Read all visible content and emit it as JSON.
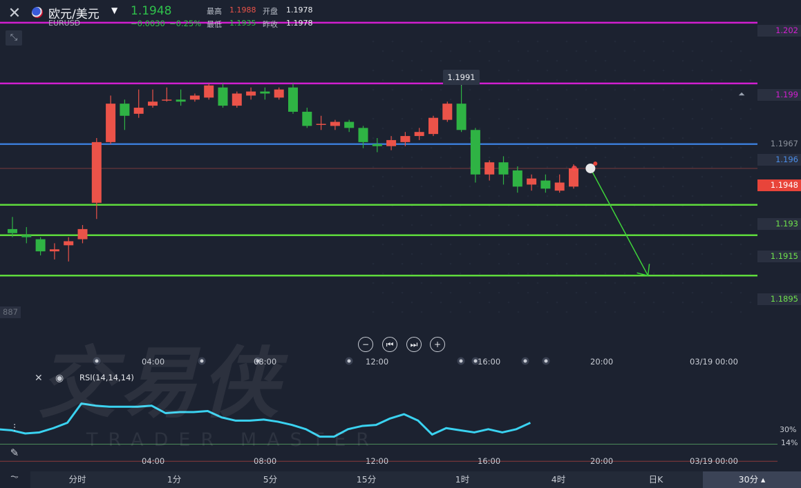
{
  "header": {
    "close_icon": "close-icon",
    "symbol_name": "欧元/美元",
    "symbol_code": "EURUSD",
    "price": "1.1948",
    "change": "−0.0030",
    "change_pct": "−0.25%",
    "high_label": "最高",
    "high_value": "1.1988",
    "open_label": "开盘",
    "open_value": "1.1978",
    "low_label": "最低",
    "low_value": "1.1935",
    "prev_label": "昨收",
    "prev_value": "1.1978"
  },
  "watermark": {
    "cn": "交易侠",
    "en": "TRADER MASTER"
  },
  "price_labels": {
    "l1": "1.202",
    "l2": "1.199",
    "l3": "1.1967",
    "l4": "1.196",
    "current": "1.1948",
    "l5": "1.193",
    "l6": "1.1915",
    "l7": "1.1895",
    "cut": "887"
  },
  "tooltip": "1.1991",
  "time_labels": [
    "04:00",
    "08:00",
    "12:00",
    "16:00",
    "20:00",
    "03/19 00:00"
  ],
  "rsi": {
    "label": "RSI(14,14,14)",
    "level30": "30%",
    "level14": "14%"
  },
  "timeframes": [
    "分时",
    "1分",
    "5分",
    "15分",
    "1时",
    "4时",
    "日K",
    "30分"
  ],
  "colors": {
    "up": "#eb5349",
    "down": "#2fb344",
    "blue_line": "#3a7bd5",
    "magenta_line": "#d21fd0",
    "green_line": "#5fdc3c",
    "rsi": "#3ad2f0"
  },
  "chart_data": {
    "type": "candlestick",
    "ylim": [
      1.1876,
      1.2021
    ],
    "levels": [
      {
        "value": 1.202,
        "color": "#d21fd0"
      },
      {
        "value": 1.199,
        "color": "#d21fd0"
      },
      {
        "value": 1.196,
        "color": "#3a7bd5"
      },
      {
        "value": 1.193,
        "color": "#5fdc3c"
      },
      {
        "value": 1.1915,
        "color": "#5fdc3c"
      },
      {
        "value": 1.1895,
        "color": "#5fdc3c"
      }
    ],
    "current_price": 1.1948,
    "candles": [
      {
        "o": 1.1918,
        "h": 1.1924,
        "l": 1.1914,
        "c": 1.1916
      },
      {
        "o": 1.1915,
        "h": 1.1919,
        "l": 1.1911,
        "c": 1.1914
      },
      {
        "o": 1.1913,
        "h": 1.1914,
        "l": 1.1905,
        "c": 1.1907
      },
      {
        "o": 1.1907,
        "h": 1.1911,
        "l": 1.1903,
        "c": 1.1908
      },
      {
        "o": 1.191,
        "h": 1.1914,
        "l": 1.1902,
        "c": 1.1912
      },
      {
        "o": 1.1913,
        "h": 1.192,
        "l": 1.1911,
        "c": 1.1918
      },
      {
        "o": 1.1931,
        "h": 1.1963,
        "l": 1.1923,
        "c": 1.1961
      },
      {
        "o": 1.1961,
        "h": 1.1984,
        "l": 1.196,
        "c": 1.198
      },
      {
        "o": 1.198,
        "h": 1.1982,
        "l": 1.1967,
        "c": 1.1974
      },
      {
        "o": 1.1975,
        "h": 1.1987,
        "l": 1.1973,
        "c": 1.1978
      },
      {
        "o": 1.1979,
        "h": 1.1987,
        "l": 1.1978,
        "c": 1.1981
      },
      {
        "o": 1.1982,
        "h": 1.1988,
        "l": 1.1981,
        "c": 1.1982
      },
      {
        "o": 1.1982,
        "h": 1.1987,
        "l": 1.1979,
        "c": 1.1981
      },
      {
        "o": 1.1982,
        "h": 1.1985,
        "l": 1.1981,
        "c": 1.1984
      },
      {
        "o": 1.1983,
        "h": 1.199,
        "l": 1.1982,
        "c": 1.1989
      },
      {
        "o": 1.1988,
        "h": 1.199,
        "l": 1.1978,
        "c": 1.1979
      },
      {
        "o": 1.1979,
        "h": 1.1986,
        "l": 1.1978,
        "c": 1.1985
      },
      {
        "o": 1.1984,
        "h": 1.1988,
        "l": 1.1982,
        "c": 1.1986
      },
      {
        "o": 1.1986,
        "h": 1.1988,
        "l": 1.1982,
        "c": 1.1985
      },
      {
        "o": 1.1983,
        "h": 1.1988,
        "l": 1.1982,
        "c": 1.1987
      },
      {
        "o": 1.1988,
        "h": 1.199,
        "l": 1.1975,
        "c": 1.1976
      },
      {
        "o": 1.1976,
        "h": 1.1978,
        "l": 1.1968,
        "c": 1.1969
      },
      {
        "o": 1.197,
        "h": 1.1974,
        "l": 1.1967,
        "c": 1.197
      },
      {
        "o": 1.1969,
        "h": 1.1972,
        "l": 1.1967,
        "c": 1.1971
      },
      {
        "o": 1.1971,
        "h": 1.1972,
        "l": 1.1966,
        "c": 1.1968
      },
      {
        "o": 1.1968,
        "h": 1.1969,
        "l": 1.1958,
        "c": 1.1961
      },
      {
        "o": 1.196,
        "h": 1.1963,
        "l": 1.1956,
        "c": 1.1959
      },
      {
        "o": 1.1959,
        "h": 1.1964,
        "l": 1.1957,
        "c": 1.1962
      },
      {
        "o": 1.1961,
        "h": 1.1966,
        "l": 1.1959,
        "c": 1.1964
      },
      {
        "o": 1.1964,
        "h": 1.1968,
        "l": 1.1962,
        "c": 1.1966
      },
      {
        "o": 1.1965,
        "h": 1.1974,
        "l": 1.1964,
        "c": 1.1973
      },
      {
        "o": 1.1972,
        "h": 1.1981,
        "l": 1.1971,
        "c": 1.198
      },
      {
        "o": 1.198,
        "h": 1.1991,
        "l": 1.1966,
        "c": 1.1967
      },
      {
        "o": 1.1967,
        "h": 1.1968,
        "l": 1.1941,
        "c": 1.1945
      },
      {
        "o": 1.1945,
        "h": 1.1952,
        "l": 1.1942,
        "c": 1.1951
      },
      {
        "o": 1.1951,
        "h": 1.1954,
        "l": 1.194,
        "c": 1.1945
      },
      {
        "o": 1.1947,
        "h": 1.1949,
        "l": 1.1936,
        "c": 1.1939
      },
      {
        "o": 1.194,
        "h": 1.1945,
        "l": 1.1937,
        "c": 1.1943
      },
      {
        "o": 1.1942,
        "h": 1.1945,
        "l": 1.1936,
        "c": 1.1938
      },
      {
        "o": 1.1937,
        "h": 1.1945,
        "l": 1.1936,
        "c": 1.1941
      },
      {
        "o": 1.1939,
        "h": 1.195,
        "l": 1.1938,
        "c": 1.1948
      }
    ],
    "projection": {
      "from": {
        "candle": 41.2,
        "price": 1.1948
      },
      "to": {
        "candle": 45.3,
        "price": 1.1895
      }
    },
    "rsi_values": [
      44,
      43,
      40,
      41,
      45,
      50,
      68,
      66,
      65,
      65,
      65,
      66,
      59,
      60,
      60,
      61,
      55,
      52,
      52,
      53,
      51,
      48,
      44,
      37,
      37,
      44,
      47,
      48,
      54,
      58,
      52,
      39,
      45,
      43,
      41,
      44,
      41,
      44,
      50
    ],
    "rsi_ylim": [
      0,
      100
    ]
  }
}
